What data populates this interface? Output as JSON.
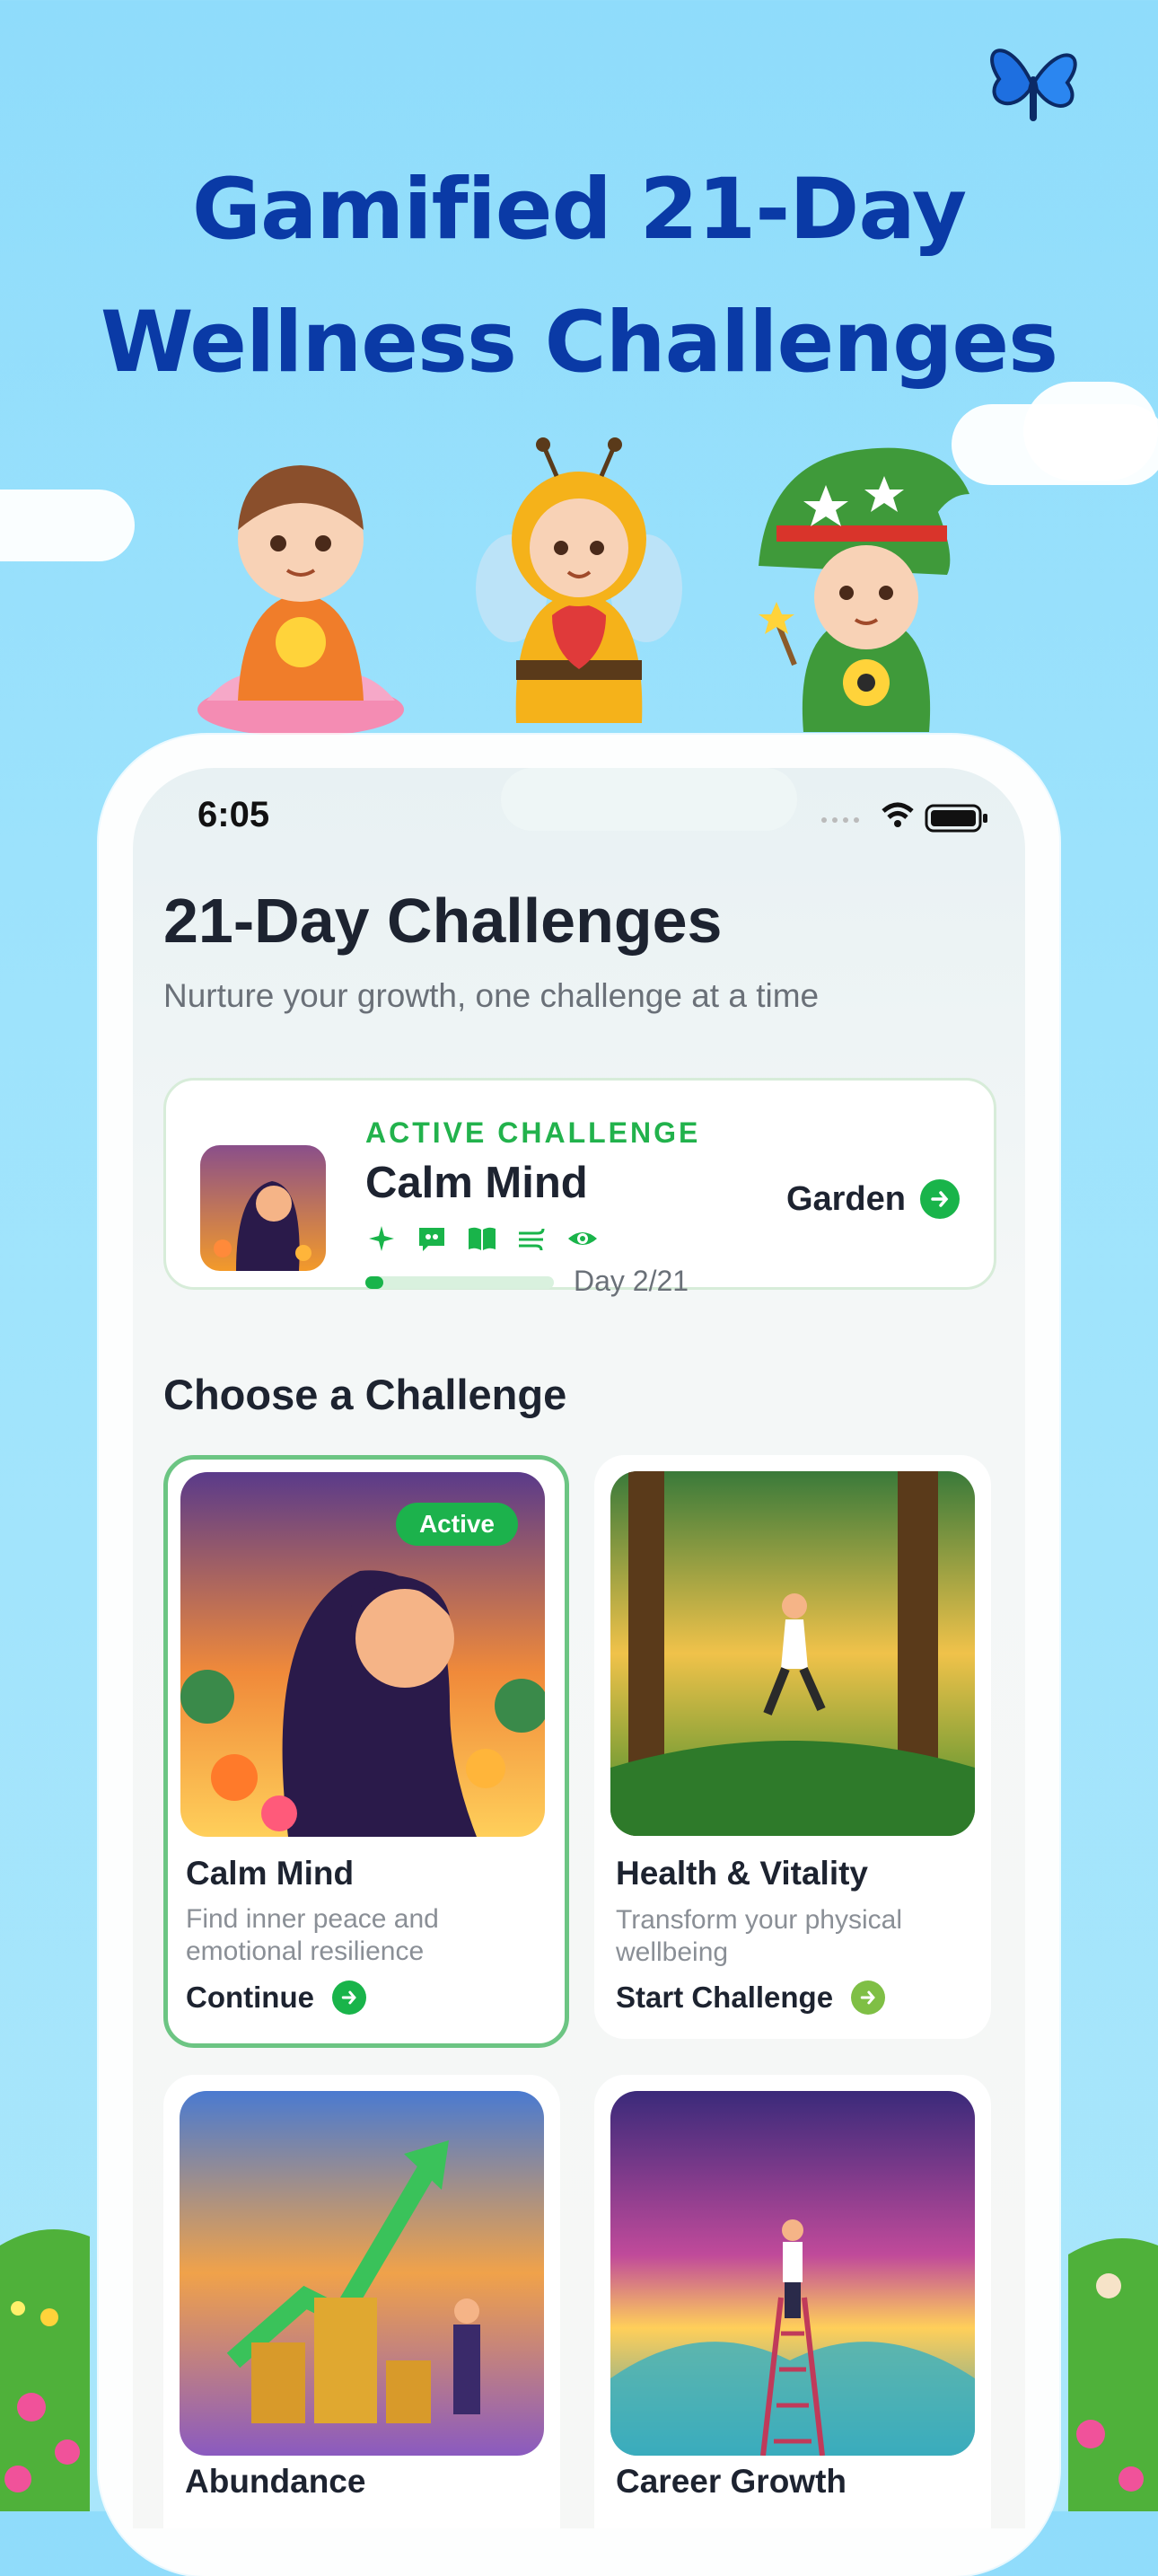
{
  "hero": {
    "line1": "Gamified 21-Day",
    "line2": "Wellness Challenges"
  },
  "status_bar": {
    "time": "6:05"
  },
  "header": {
    "title": "21-Day Challenges",
    "subtitle": "Nurture your growth, one challenge at a time"
  },
  "active_challenge": {
    "label": "ACTIVE CHALLENGE",
    "name": "Calm Mind",
    "icons": [
      "sparkle-icon",
      "quote-bubble-icon",
      "book-icon",
      "wind-icon",
      "eye-icon"
    ],
    "progress_fraction": 0.095,
    "progress_text": "Day 2/21",
    "garden_label": "Garden"
  },
  "section": {
    "title": "Choose a Challenge"
  },
  "challenges": [
    {
      "title": "Calm Mind",
      "desc": "Find inner peace and emotional resilience",
      "action": "Continue",
      "badge": "Active"
    },
    {
      "title": "Health & Vitality",
      "desc": "Transform your physical wellbeing",
      "action": "Start Challenge"
    },
    {
      "title": "Abundance"
    },
    {
      "title": "Career Growth"
    }
  ],
  "colors": {
    "accent_green": "#19b44a",
    "hero_blue": "#0a3aa6",
    "sky": "#9ee3fc"
  }
}
